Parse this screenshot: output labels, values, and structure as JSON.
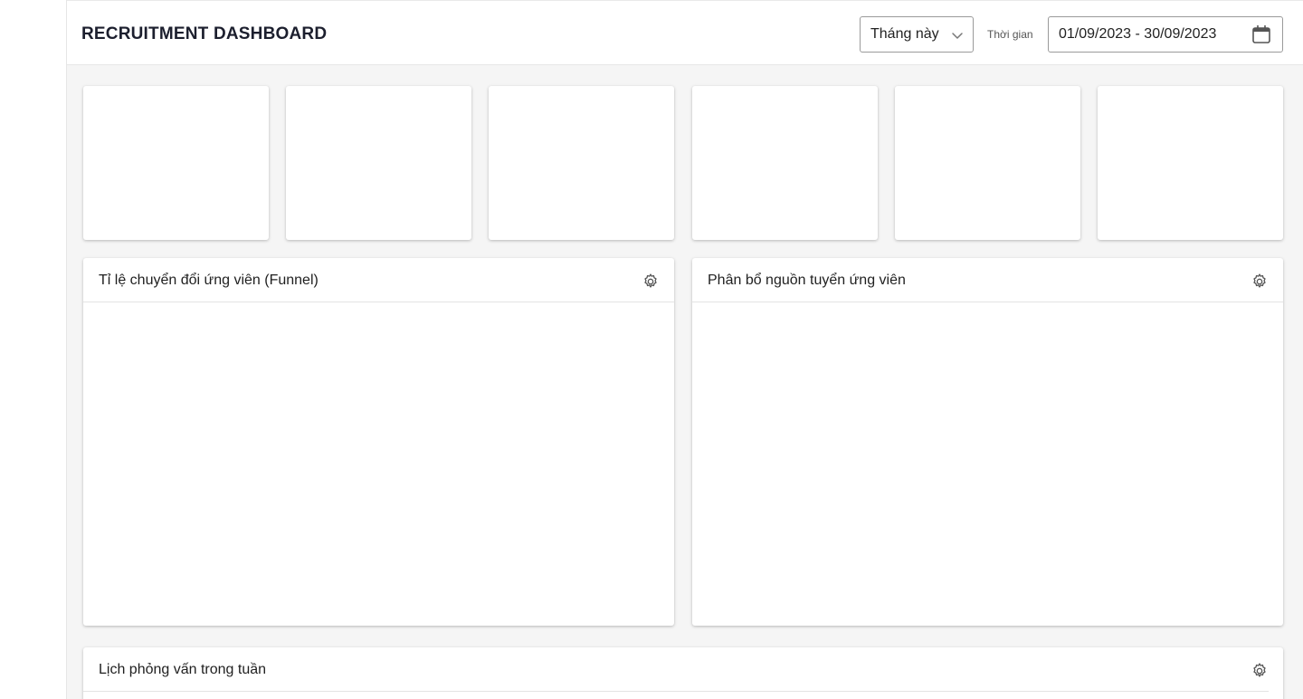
{
  "header": {
    "title": "RECRUITMENT DASHBOARD",
    "period_select": {
      "value": "Tháng này",
      "icon": "chevron-down-icon"
    },
    "time_label": "Thời gian",
    "date_range": {
      "value": "01/09/2023 - 30/09/2023",
      "icon": "calendar-icon"
    }
  },
  "kpi_cards": [
    {
      "id": 1
    },
    {
      "id": 2
    },
    {
      "id": 3
    },
    {
      "id": 4
    },
    {
      "id": 5
    },
    {
      "id": 6
    }
  ],
  "panels": {
    "funnel": {
      "title": "Tỉ lệ chuyển đổi ứng viên (Funnel)",
      "icon": "gear-icon"
    },
    "sources": {
      "title": "Phân bổ nguồn tuyển ứng viên",
      "icon": "gear-icon"
    },
    "interviews": {
      "title": "Lịch phỏng vấn trong tuần",
      "icon": "gear-icon"
    }
  },
  "colors": {
    "background": "#f5f5f5",
    "card": "#ffffff",
    "title_text": "#1c1f2e",
    "border": "#9a9a9a"
  }
}
